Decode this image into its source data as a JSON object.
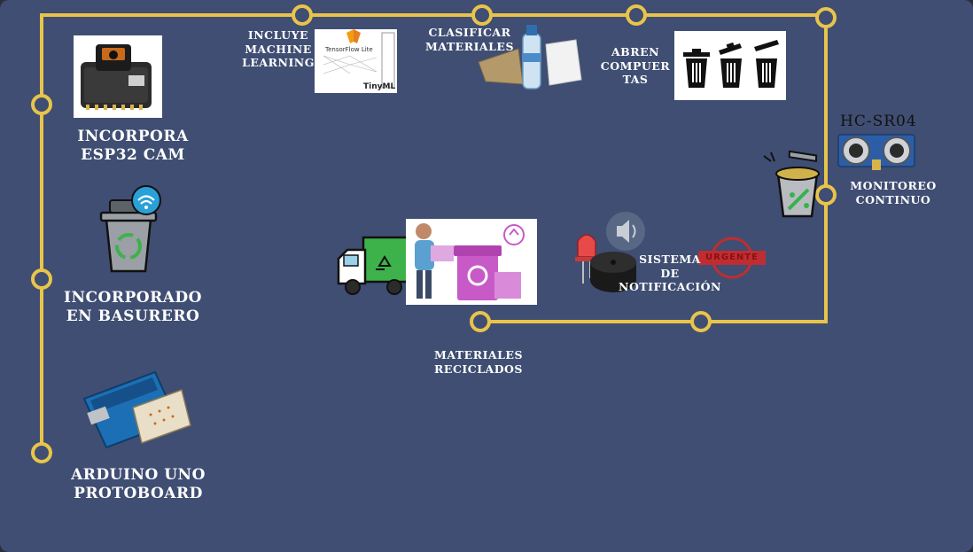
{
  "colors": {
    "background": "#3f4e72",
    "track": "#e8c44a",
    "text": "#ffffff",
    "dark_text": "#111111"
  },
  "labels": {
    "esp32": [
      "INCORPORA",
      "ESP32 CAM"
    ],
    "basurero": [
      "INCORPORADO",
      "EN BASURERO"
    ],
    "arduino": [
      "ARDUINO UNO",
      "PROTOBOARD"
    ],
    "ml": [
      "INCLUYE",
      "MACHINE",
      "LEARNING"
    ],
    "clasificar": [
      "CLASIFICAR",
      "MATERIALES"
    ],
    "abren": [
      "ABREN",
      "COMPUER",
      "TAS"
    ],
    "sensor": "HC-SR04",
    "monitoreo": [
      "MONITOREO",
      "CONTINUO"
    ],
    "notificacion": [
      "SISTEMA",
      "DE",
      "NOTIFICACIÓN"
    ],
    "reciclados": [
      "MATERIALES",
      "RECICLADOS"
    ],
    "tf_badge": "TensorFlow Lite",
    "tinyml": "TinyML",
    "stamp": "URGENTE"
  },
  "icons": [
    "esp32-cam-board-icon",
    "smart-trash-bin-wifi-icon",
    "arduino-board-icon",
    "tensorflow-tinyml-icon",
    "materials-icon",
    "trash-cans-icon",
    "ultrasonic-sensor-icon",
    "full-bin-icon",
    "recycling-truck-icon",
    "recycling-illustration-icon",
    "led-icon",
    "buzzer-icon",
    "speaker-icon",
    "urgent-stamp-icon"
  ]
}
